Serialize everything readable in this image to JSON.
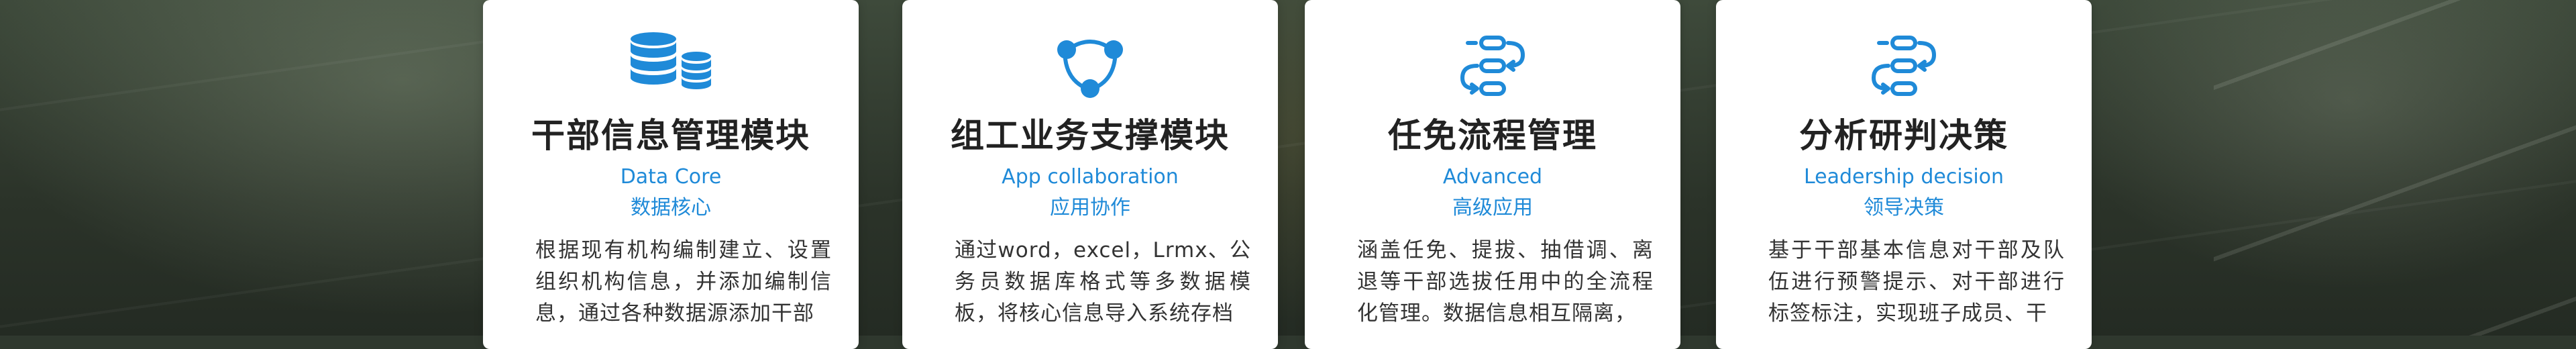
{
  "colors": {
    "accent": "#1f8ad8",
    "title": "#222222",
    "text": "#333333",
    "card": "#ffffff"
  },
  "cards": [
    {
      "icon": "database-icon",
      "title": "干部信息管理模块",
      "sub_en": "Data Core",
      "sub_cn": "数据核心",
      "desc": "根据现有机构编制建立、设置组织机构信息，并添加编制信息，通过各种数据源添加干部"
    },
    {
      "icon": "network-icon",
      "title": "组工业务支撑模块",
      "sub_en": "App collaboration",
      "sub_cn": "应用协作",
      "desc": "通过word，excel，Lrmx、公务员数据库格式等多数据模板，将核心信息导入系统存档"
    },
    {
      "icon": "workflow-icon",
      "title": "任免流程管理",
      "sub_en": "Advanced",
      "sub_cn": "高级应用",
      "desc": "涵盖任免、提拔、抽借调、离退等干部选拔任用中的全流程化管理。数据信息相互隔离，"
    },
    {
      "icon": "workflow-icon",
      "title": "分析研判决策",
      "sub_en": "Leadership decision",
      "sub_cn": "领导决策",
      "desc": "基于干部基本信息对干部及队伍进行预警提示、对干部进行标签标注，实现班子成员、干"
    }
  ]
}
